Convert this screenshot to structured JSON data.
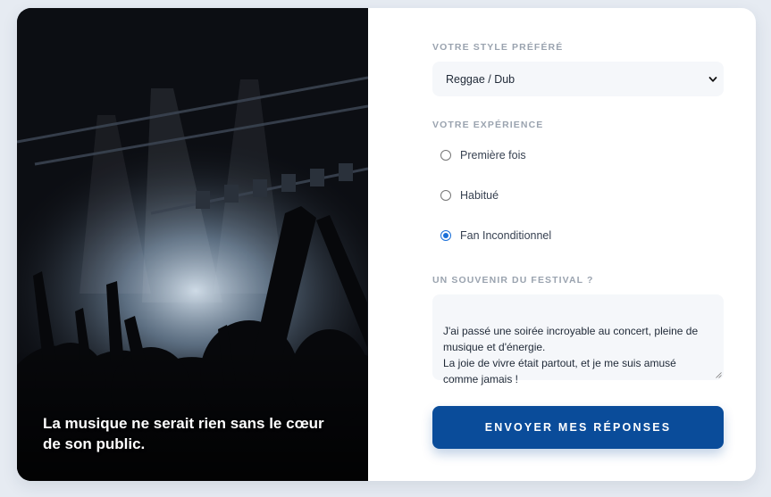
{
  "visual": {
    "caption": "La musique ne serait rien sans le cœur de son public."
  },
  "form": {
    "style": {
      "label": "VOTRE STYLE PRÉFÉRÉ",
      "selected": "Reggae / Dub"
    },
    "experience": {
      "label": "VOTRE EXPÉRIENCE",
      "options": [
        "Première fois",
        "Habitué",
        "Fan Inconditionnel"
      ],
      "selected": "Fan Inconditionnel"
    },
    "memory": {
      "label": "UN SOUVENIR DU FESTIVAL ?",
      "value": "J'ai passé une soirée incroyable au concert, pleine de musique et d'énergie.\nLa joie de vivre était partout, et je me suis amusé comme jamais !"
    },
    "submit_label": "ENVOYER MES RÉPONSES"
  },
  "colors": {
    "accent": "#0a4c9a",
    "radio_checked": "#1a6fd8",
    "label": "#9aa3af",
    "field_bg": "#f5f7fa",
    "page_bg": "#e6ebf2"
  },
  "icons": [
    "chevron-down-icon",
    "resize-handle-icon"
  ]
}
